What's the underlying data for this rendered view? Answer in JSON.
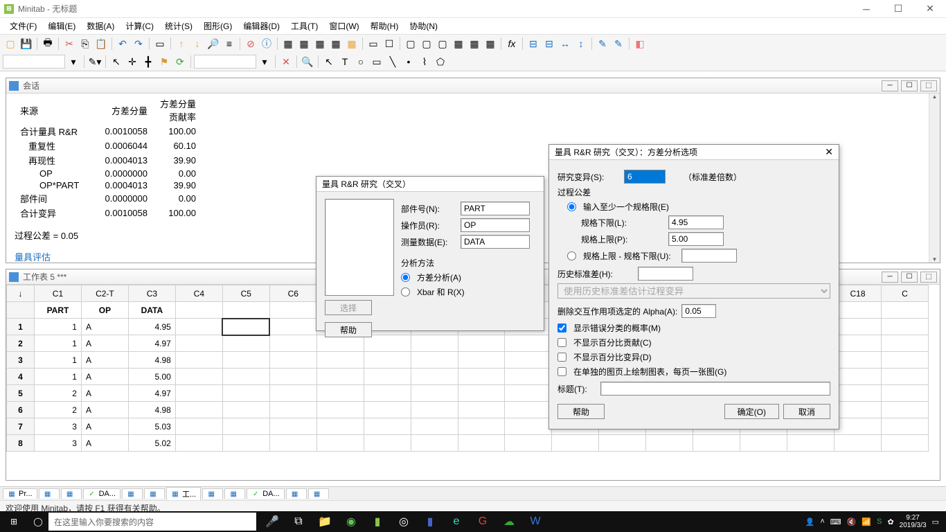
{
  "app": {
    "title": "Minitab - 无标题"
  },
  "menu": [
    "文件(F)",
    "编辑(E)",
    "数据(A)",
    "计算(C)",
    "统计(S)",
    "图形(G)",
    "编辑器(D)",
    "工具(T)",
    "窗口(W)",
    "帮助(H)",
    "协助(N)"
  ],
  "session": {
    "title": "会话",
    "header": [
      "来源",
      "方差分量",
      "方差分量\n贡献率"
    ],
    "rows": [
      [
        "合计量具 R&R",
        "0.0010058",
        "100.00"
      ],
      [
        "重复性",
        "0.0006044",
        "60.10"
      ],
      [
        "再现性",
        "0.0004013",
        "39.90"
      ],
      [
        "OP",
        "0.0000000",
        "0.00"
      ],
      [
        "OP*PART",
        "0.0004013",
        "39.90"
      ],
      [
        "部件间",
        "0.0000000",
        "0.00"
      ],
      [
        "合计变异",
        "0.0010058",
        "100.00"
      ]
    ],
    "tolerance": "过程公差 = 0.05",
    "eval": "量具评估"
  },
  "worksheet": {
    "title": "工作表 5 ***",
    "columns": [
      "C1",
      "C2-T",
      "C3",
      "C4",
      "C5",
      "C6",
      "",
      "",
      "",
      "",
      "",
      "",
      "",
      "",
      "",
      "",
      "",
      "C18",
      "C"
    ],
    "names": [
      "PART",
      "OP",
      "DATA",
      "",
      "",
      "",
      "",
      "",
      "",
      "",
      "",
      "",
      "",
      "",
      "",
      "",
      "",
      "",
      ""
    ],
    "rows": [
      [
        "1",
        "A",
        "4.95"
      ],
      [
        "1",
        "A",
        "4.97"
      ],
      [
        "1",
        "A",
        "4.98"
      ],
      [
        "1",
        "A",
        "5.00"
      ],
      [
        "2",
        "A",
        "4.97"
      ],
      [
        "2",
        "A",
        "4.98"
      ],
      [
        "3",
        "A",
        "5.03"
      ],
      [
        "3",
        "A",
        "5.02"
      ]
    ]
  },
  "dialog1": {
    "title": "量具 R&R 研究（交叉）",
    "part_label": "部件号(N):",
    "part_val": "PART",
    "op_label": "操作员(R):",
    "op_val": "OP",
    "data_label": "测量数据(E):",
    "data_val": "DATA",
    "method_title": "分析方法",
    "method_anova": "方差分析(A)",
    "method_xbar": "Xbar 和 R(X)",
    "select": "选择",
    "help": "帮助"
  },
  "dialog2": {
    "title": "量具 R&R 研究（交叉）：方差分析选项",
    "study_label": "研究变异(S):",
    "study_val": "6",
    "study_hint": "（标准差倍数）",
    "pt_title": "过程公差",
    "pt_radio1": "输入至少一个规格限(E)",
    "lsl_label": "规格下限(L):",
    "lsl_val": "4.95",
    "usl_label": "规格上限(P):",
    "usl_val": "5.00",
    "pt_radio2": "规格上限 - 规格下限(U):",
    "hist_label": "历史标准差(H):",
    "hist_select": "使用历史标准差估计过程变异",
    "alpha_label": "删除交互作用项选定的 Alpha(A):",
    "alpha_val": "0.05",
    "cb1": "显示错误分类的概率(M)",
    "cb2": "不显示百分比贡献(C)",
    "cb3": "不显示百分比变异(D)",
    "cb4": "在单独的图页上绘制图表，每页一张图(G)",
    "title_label": "标题(T):",
    "help": "帮助",
    "ok": "确定(O)",
    "cancel": "取消"
  },
  "tabs": [
    {
      "icon": "▦",
      "label": "Pr..."
    },
    {
      "icon": "▦",
      "label": ""
    },
    {
      "icon": "▦",
      "label": ""
    },
    {
      "icon": "✓",
      "label": "DA...",
      "color": "#3a3"
    },
    {
      "icon": "▦",
      "label": ""
    },
    {
      "icon": "▦",
      "label": ""
    },
    {
      "icon": "▦",
      "label": "工..."
    },
    {
      "icon": "▦",
      "label": ""
    },
    {
      "icon": "▦",
      "label": ""
    },
    {
      "icon": "✓",
      "label": "DA...",
      "color": "#3a3"
    },
    {
      "icon": "▦",
      "label": ""
    },
    {
      "icon": "▦",
      "label": ""
    }
  ],
  "status": "欢迎使用 Minitab，请按 F1 获得有关帮助。",
  "taskbar": {
    "search_placeholder": "在这里输入你要搜索的内容",
    "time": "9:27",
    "date": "2019/3/3"
  }
}
